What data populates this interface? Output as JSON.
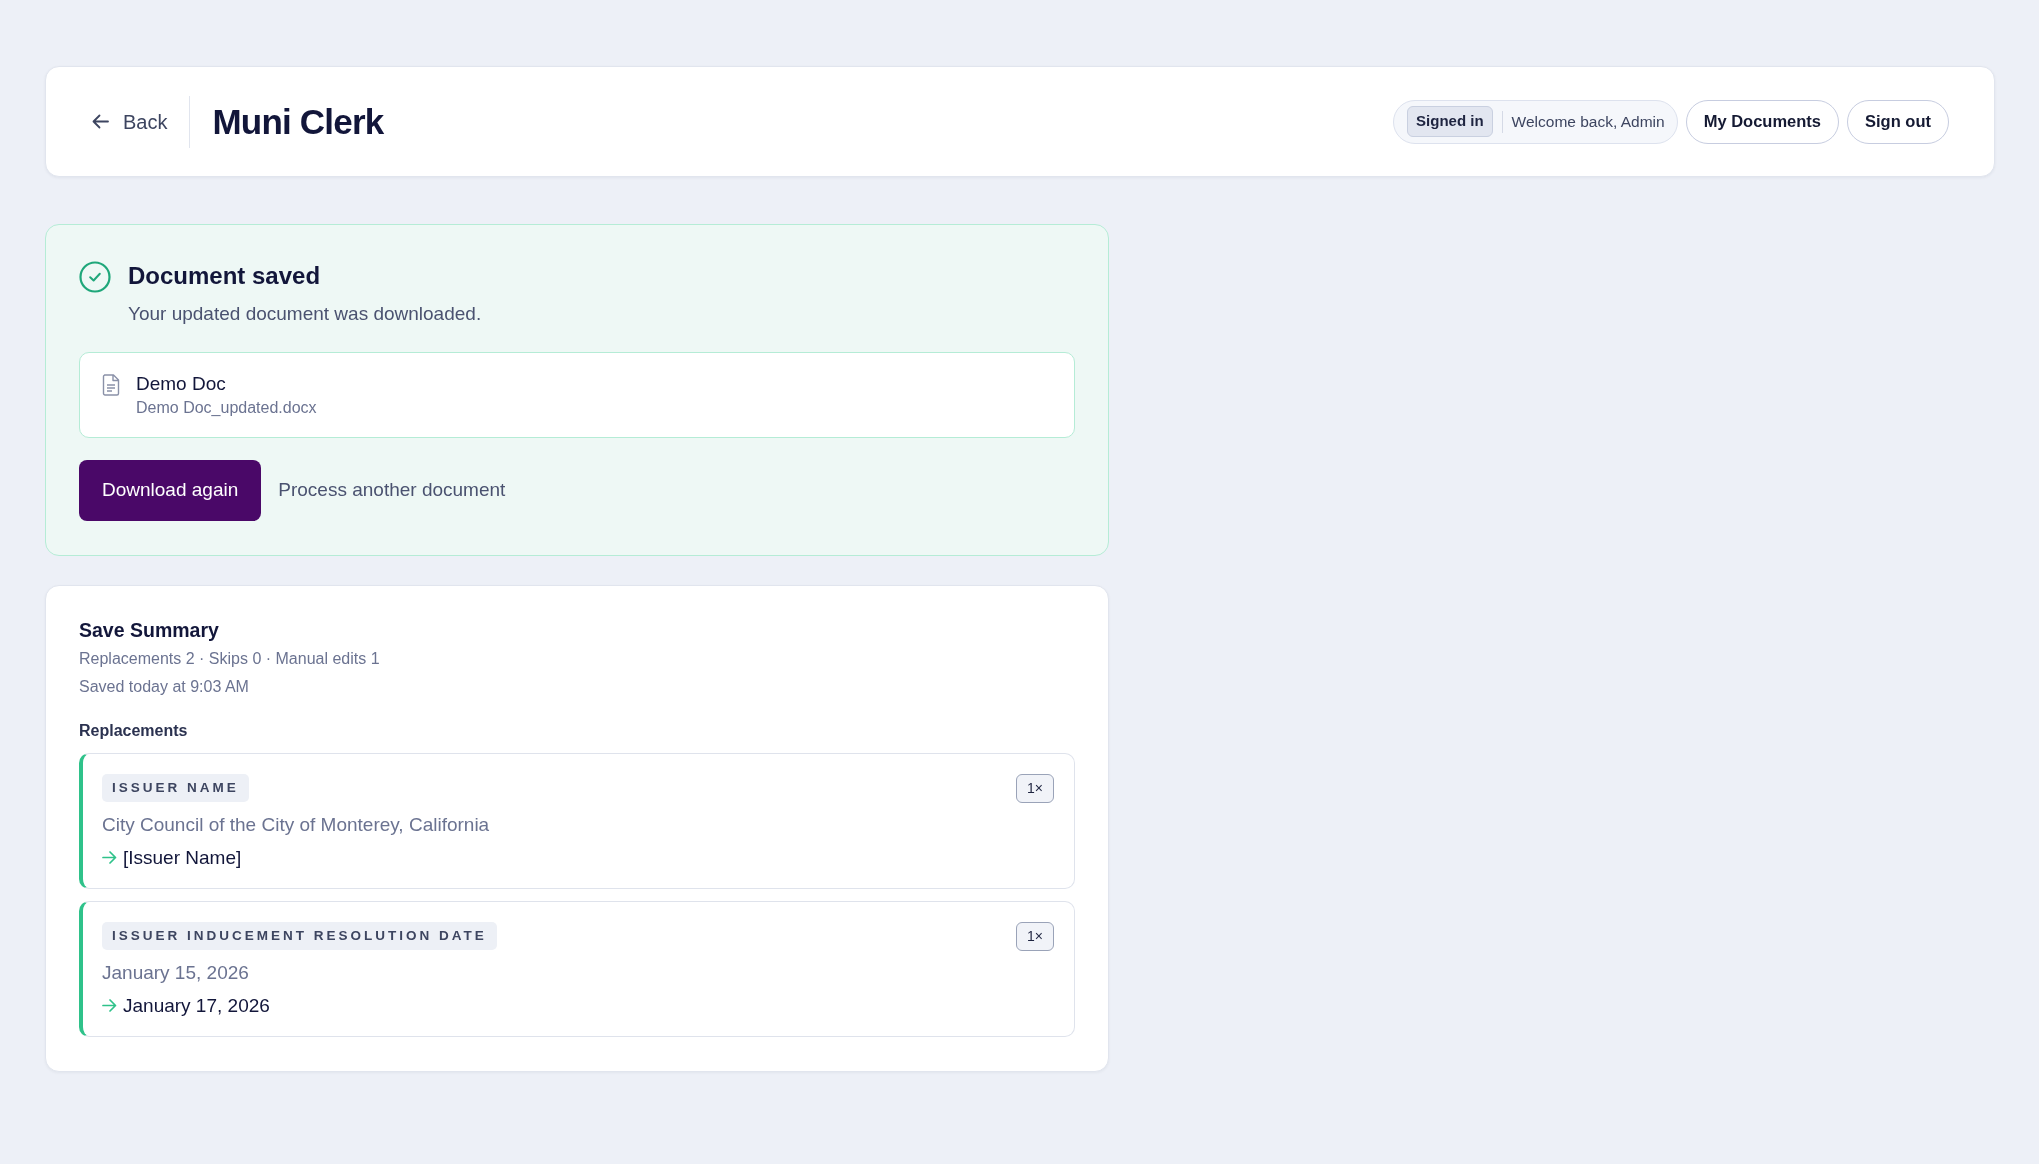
{
  "header": {
    "back_label": "Back",
    "title": "Muni Clerk",
    "status_badge": "Signed in",
    "welcome": "Welcome back, Admin",
    "buttons": [
      "My Documents",
      "Sign out"
    ]
  },
  "notice": {
    "title": "Document saved",
    "message": "Your updated document was downloaded.",
    "file": {
      "name": "Demo Doc",
      "filename": "Demo Doc_updated.docx"
    },
    "primary_action": "Download again",
    "secondary_action": "Process another document"
  },
  "summary": {
    "title": "Save Summary",
    "stats": "Replacements 2 · Skips 0 · Manual edits 1",
    "saved_at": "Saved today at 9:03 AM",
    "section_label": "Replacements",
    "replacements": [
      {
        "field": "ISSUER NAME",
        "count": "1×",
        "original": "City Council of the City of Monterey, California",
        "replacement": "[Issuer Name]"
      },
      {
        "field": "ISSUER INDUCEMENT RESOLUTION DATE",
        "count": "1×",
        "original": "January 15, 2026",
        "replacement": "January 17, 2026"
      }
    ]
  }
}
